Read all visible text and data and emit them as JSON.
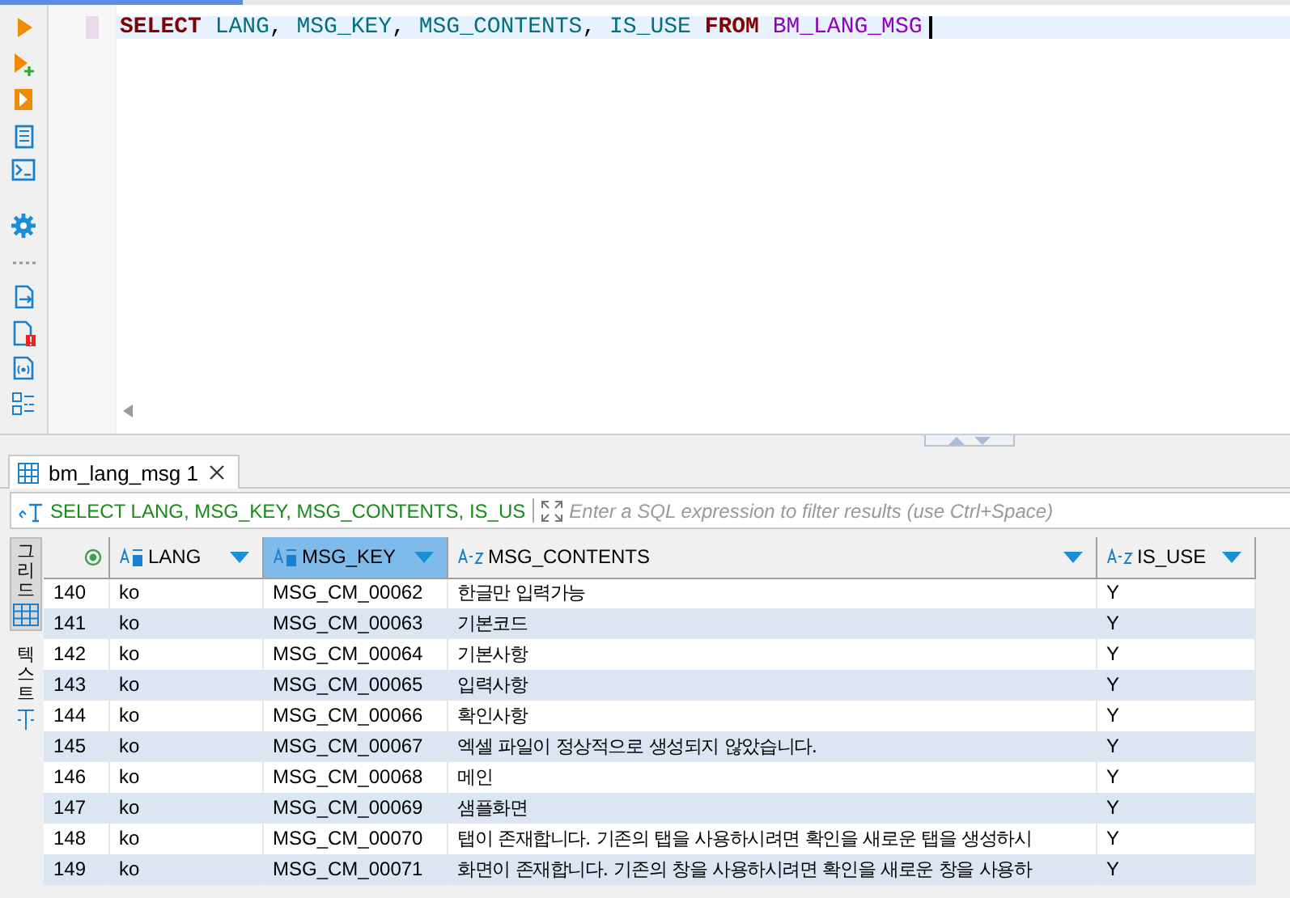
{
  "editor": {
    "tokens": [
      {
        "text": "SELECT ",
        "kind": "keyword"
      },
      {
        "text": "LANG",
        "kind": "column"
      },
      {
        "text": ", ",
        "kind": "punct"
      },
      {
        "text": "MSG_KEY",
        "kind": "column"
      },
      {
        "text": ", ",
        "kind": "punct"
      },
      {
        "text": "MSG_CONTENTS",
        "kind": "column"
      },
      {
        "text": ", ",
        "kind": "punct"
      },
      {
        "text": "IS_USE ",
        "kind": "column"
      },
      {
        "text": "FROM ",
        "kind": "keyword"
      },
      {
        "text": "BM_LANG_MSG",
        "kind": "table"
      }
    ]
  },
  "results": {
    "tab": {
      "label": "bm_lang_msg 1",
      "selected": true
    },
    "filter": {
      "query": "SELECT LANG, MSG_KEY, MSG_CONTENTS, IS_US",
      "placeholder": "Enter a SQL expression to filter results (use Ctrl+Space)"
    },
    "view_tabs": [
      {
        "label": "그리드",
        "selected": true
      },
      {
        "label": "텍스트",
        "selected": false
      }
    ],
    "columns": [
      {
        "label": "LANG",
        "kind": "key",
        "selected": false
      },
      {
        "label": "MSG_KEY",
        "kind": "key",
        "selected": true
      },
      {
        "label": "MSG_CONTENTS",
        "kind": "text",
        "selected": false
      },
      {
        "label": "IS_USE",
        "kind": "text",
        "selected": false
      }
    ],
    "rows": [
      {
        "num": "140",
        "cells": [
          "ko",
          "MSG_CM_00062",
          "한글만 입력가능",
          "Y"
        ]
      },
      {
        "num": "141",
        "cells": [
          "ko",
          "MSG_CM_00063",
          "기본코드",
          "Y"
        ]
      },
      {
        "num": "142",
        "cells": [
          "ko",
          "MSG_CM_00064",
          "기본사항",
          "Y"
        ]
      },
      {
        "num": "143",
        "cells": [
          "ko",
          "MSG_CM_00065",
          "입력사항",
          "Y"
        ]
      },
      {
        "num": "144",
        "cells": [
          "ko",
          "MSG_CM_00066",
          "확인사항",
          "Y"
        ]
      },
      {
        "num": "145",
        "cells": [
          "ko",
          "MSG_CM_00067",
          "엑셀 파일이 정상적으로 생성되지 않았습니다.",
          "Y"
        ]
      },
      {
        "num": "146",
        "cells": [
          "ko",
          "MSG_CM_00068",
          "메인",
          "Y"
        ]
      },
      {
        "num": "147",
        "cells": [
          "ko",
          "MSG_CM_00069",
          "샘플화면",
          "Y"
        ]
      },
      {
        "num": "148",
        "cells": [
          "ko",
          "MSG_CM_00070",
          "탭이 존재합니다. 기존의 탭을 사용하시려면 확인을 새로운 탭을 생성하시",
          "Y"
        ]
      },
      {
        "num": "149",
        "cells": [
          "ko",
          "MSG_CM_00071",
          "화면이 존재합니다. 기존의 창을 사용하시려면 확인을 새로운 창을 사용하",
          "Y"
        ]
      }
    ]
  }
}
